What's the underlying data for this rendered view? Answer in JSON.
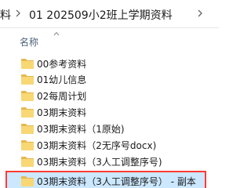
{
  "breadcrumb": {
    "partial_left": "料",
    "current": "01 202509小2班上学期资料"
  },
  "column": {
    "name_header": "名称"
  },
  "files": [
    {
      "name": "00参考资料"
    },
    {
      "name": "01幼儿信息"
    },
    {
      "name": "02每周计划"
    },
    {
      "name": "03期末资料"
    },
    {
      "name": "03期末资料（1原始)"
    },
    {
      "name": "03期末资料（2无序号docx)"
    },
    {
      "name": "03期末资料（3人工调整序号)"
    },
    {
      "name": "03期末资料（3人工调整序号） - 副本",
      "selected": true
    }
  ],
  "colors": {
    "folder_body": "#f8d775",
    "folder_tab": "#e6b84d",
    "selection": "#cce8ff",
    "highlight_border": "#ff3b30"
  }
}
